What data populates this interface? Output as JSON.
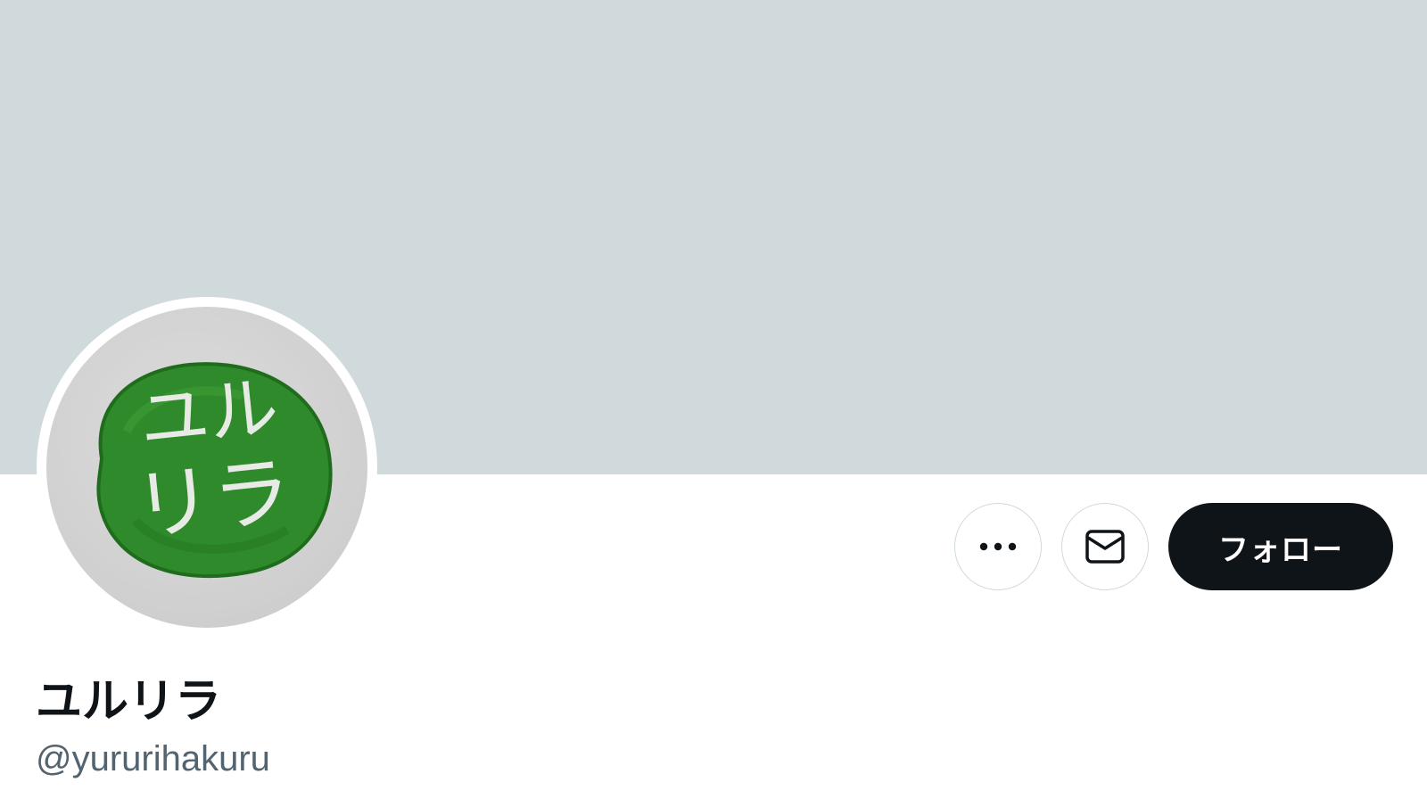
{
  "profile": {
    "display_name": "ユルリラ",
    "handle": "@yururihakuru",
    "avatar_text": "ユルリラ",
    "follow_label": "フォロー"
  },
  "icons": {
    "more": "more-horizontal-icon",
    "message": "envelope-icon"
  },
  "colors": {
    "banner": "#d0d9dc",
    "follow_bg": "#0f1419",
    "handle_text": "#536471",
    "avatar_green": "#2f8a2b"
  }
}
